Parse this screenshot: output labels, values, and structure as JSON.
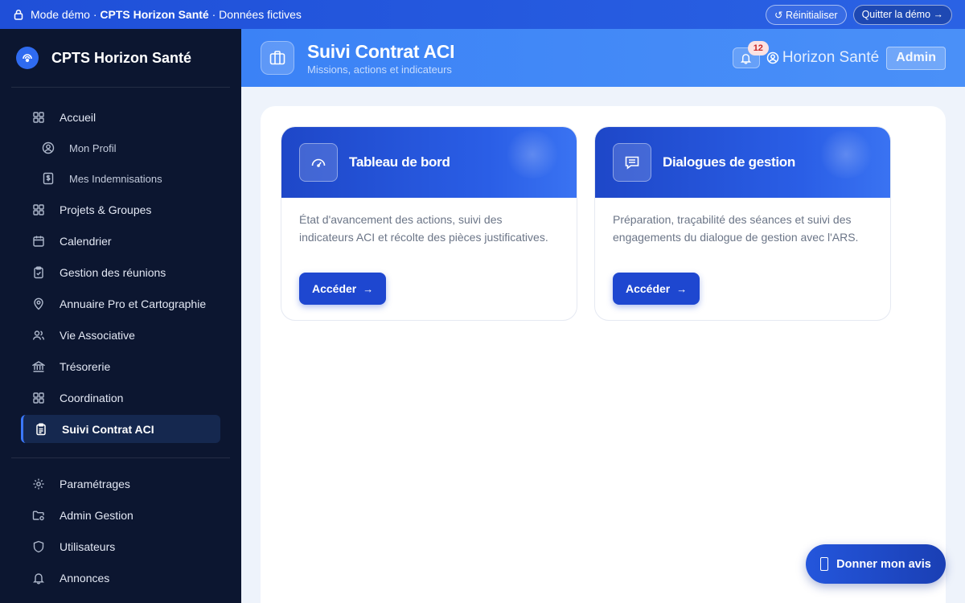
{
  "demo_bar": {
    "prefix": "Mode démo · ",
    "org": "CPTS Horizon Santé",
    "suffix": " · Données fictives",
    "reset_label": "↺ Réinitialiser",
    "quit_label": "Quitter la démo →"
  },
  "sidebar": {
    "brand": "CPTS Horizon Santé",
    "items": [
      {
        "label": "Accueil",
        "icon": "grid-icon"
      },
      {
        "label": "Mon Profil",
        "icon": "user-circle-icon"
      },
      {
        "label": "Mes Indemnisations",
        "icon": "dollar-icon"
      },
      {
        "label": "Projets & Groupes",
        "icon": "grid-icon"
      },
      {
        "label": "Calendrier",
        "icon": "calendar-icon"
      },
      {
        "label": "Gestion des réunions",
        "icon": "clipboard-check-icon"
      },
      {
        "label": "Annuaire Pro et Cartographie",
        "icon": "map-pin-icon"
      },
      {
        "label": "Vie Associative",
        "icon": "users-icon"
      },
      {
        "label": "Trésorerie",
        "icon": "bank-icon"
      },
      {
        "label": "Coordination",
        "icon": "grid-icon"
      },
      {
        "label": "Suivi Contrat ACI",
        "icon": "clipboard-icon"
      }
    ],
    "admin_items": [
      {
        "label": "Paramétrages",
        "icon": "gear-icon"
      },
      {
        "label": "Admin Gestion",
        "icon": "folder-gear-icon"
      },
      {
        "label": "Utilisateurs",
        "icon": "shield-icon"
      },
      {
        "label": "Annonces",
        "icon": "bell-icon"
      }
    ]
  },
  "header": {
    "title": "Suivi Contrat ACI",
    "subtitle": "Missions, actions et indicateurs",
    "notif_count": "12",
    "user": "Horizon Santé",
    "role": "Admin"
  },
  "cards": [
    {
      "title": "Tableau de bord",
      "icon": "gauge-icon",
      "description": "État d'avancement des actions, suivi des indicateurs ACI et récolte des pièces justificatives.",
      "button": "Accéder"
    },
    {
      "title": "Dialogues de gestion",
      "icon": "message-icon",
      "description": "Préparation, traçabilité des séances et suivi des engagements du dialogue de gestion avec l'ARS.",
      "button": "Accéder"
    }
  ],
  "fab": {
    "label": "Donner mon avis"
  },
  "colors": {
    "sidebar_bg": "#0c1630",
    "accent": "#1e47d0",
    "header": "#3b82f6"
  }
}
